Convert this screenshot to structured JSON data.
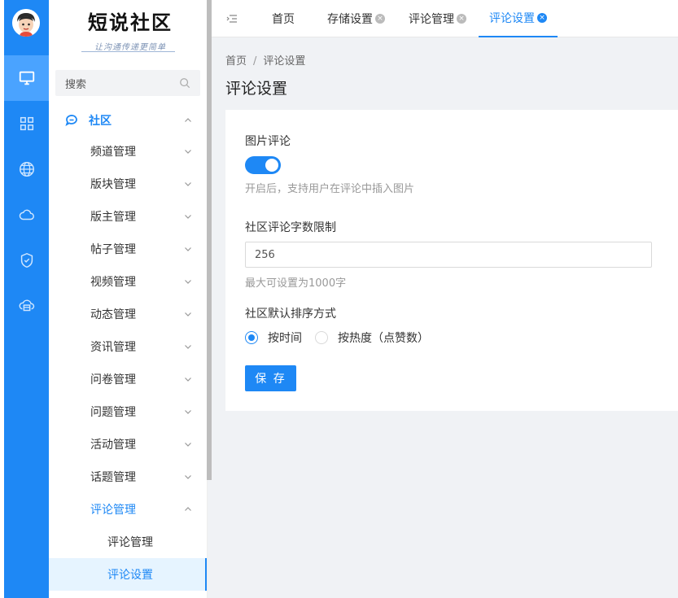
{
  "logo": {
    "title": "短说社区",
    "slogan": "让沟通传递更简单"
  },
  "search": {
    "placeholder": "搜索"
  },
  "rail": {
    "items": [
      "desktop-icon",
      "grid-icon",
      "globe-icon",
      "cloud-icon",
      "shield-icon",
      "cloud-box-icon"
    ],
    "active": 0
  },
  "menu": {
    "group": "社区",
    "items": [
      "频道管理",
      "版块管理",
      "版主管理",
      "帖子管理",
      "视频管理",
      "动态管理",
      "资讯管理",
      "问卷管理",
      "问题管理",
      "活动管理",
      "话题管理"
    ],
    "open_item": "评论管理",
    "sub_items": [
      "评论管理",
      "评论设置"
    ],
    "selected": "评论设置"
  },
  "tabs": [
    {
      "label": "首页",
      "closable": false
    },
    {
      "label": "存储设置",
      "closable": true
    },
    {
      "label": "评论管理",
      "closable": true
    },
    {
      "label": "评论设置",
      "closable": true,
      "active": true
    }
  ],
  "breadcrumb": {
    "home": "首页",
    "sep": "/",
    "current": "评论设置"
  },
  "page": {
    "title": "评论设置"
  },
  "form": {
    "image_comment": {
      "label": "图片评论",
      "enabled": true,
      "help": "开启后，支持用户在评论中插入图片"
    },
    "char_limit": {
      "label": "社区评论字数限制",
      "value": "256",
      "help": "最大可设置为1000字"
    },
    "sort": {
      "label": "社区默认排序方式",
      "options": [
        "按时间",
        "按热度（点赞数）"
      ],
      "selected": "按时间"
    },
    "save_label": "保 存"
  },
  "colors": {
    "primary": "#1e88f5",
    "rail_active": "#4aa3ff"
  }
}
